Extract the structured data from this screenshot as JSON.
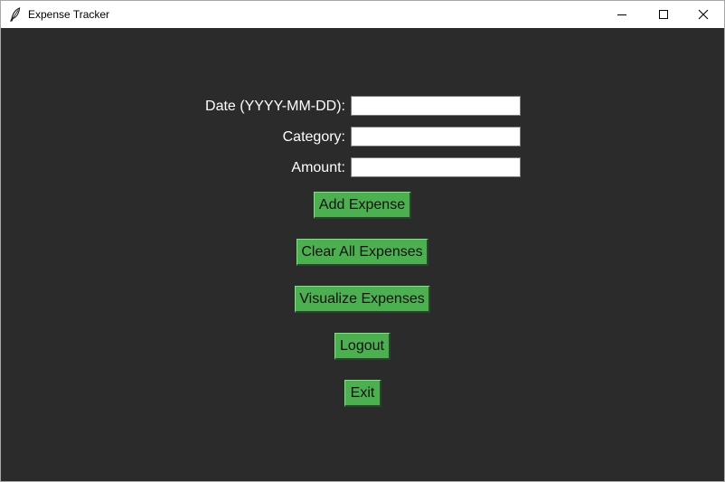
{
  "window": {
    "title": "Expense Tracker",
    "icon": "feather-icon",
    "controls": {
      "minimize": "minimize-icon",
      "maximize": "maximize-icon",
      "close": "close-icon"
    }
  },
  "form": {
    "date_label": "Date (YYYY-MM-DD):",
    "date_value": "",
    "category_label": "Category:",
    "category_value": "",
    "amount_label": "Amount:",
    "amount_value": ""
  },
  "buttons": {
    "add_expense": "Add Expense",
    "clear_all": "Clear All Expenses",
    "visualize": "Visualize Expenses",
    "logout": "Logout",
    "exit": "Exit"
  },
  "colors": {
    "background": "#2b2b2b",
    "button": "#4caf50",
    "label_text": "#ffffff"
  }
}
